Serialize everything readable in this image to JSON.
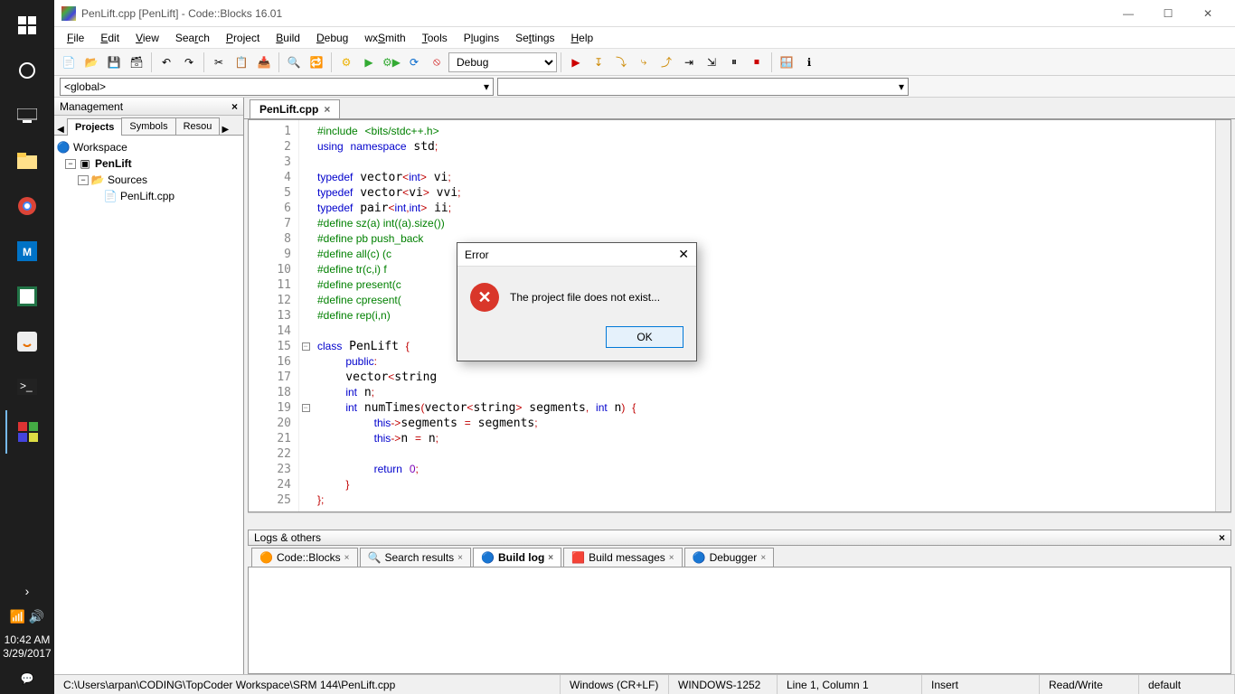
{
  "window": {
    "title": "PenLift.cpp [PenLift] - Code::Blocks 16.01"
  },
  "menu": [
    "File",
    "Edit",
    "View",
    "Search",
    "Project",
    "Build",
    "Debug",
    "wxSmith",
    "Tools",
    "Plugins",
    "Settings",
    "Help"
  ],
  "toolbar_combo": "Debug",
  "scope": {
    "left": "<global>",
    "right": ""
  },
  "management": {
    "title": "Management",
    "tabs": [
      "Projects",
      "Symbols",
      "Resou"
    ],
    "active_tab": 0,
    "tree": {
      "workspace": "Workspace",
      "project": "PenLift",
      "folder": "Sources",
      "file": "PenLift.cpp"
    }
  },
  "editor": {
    "tab": "PenLift.cpp",
    "lines": [
      {
        "n": 1,
        "html": "<span class='pp'>#include</span> <span class='pp'>&lt;bits/stdc++.h&gt;</span>"
      },
      {
        "n": 2,
        "html": "<span class='kw'>using</span> <span class='kw'>namespace</span> std<span class='pn'>;</span>"
      },
      {
        "n": 3,
        "html": ""
      },
      {
        "n": 4,
        "html": "<span class='kw'>typedef</span> vector<span class='pn'>&lt;</span><span class='kw'>int</span><span class='pn'>&gt;</span> vi<span class='pn'>;</span>"
      },
      {
        "n": 5,
        "html": "<span class='kw'>typedef</span> vector<span class='pn'>&lt;</span>vi<span class='pn'>&gt;</span> vvi<span class='pn'>;</span>"
      },
      {
        "n": 6,
        "html": "<span class='kw'>typedef</span> pair<span class='pn'>&lt;</span><span class='kw'>int</span><span class='pn'>,</span><span class='kw'>int</span><span class='pn'>&gt;</span> ii<span class='pn'>;</span>"
      },
      {
        "n": 7,
        "html": "<span class='pp'>#define sz(a) int((a).size())</span>"
      },
      {
        "n": 8,
        "html": "<span class='pp'>#define pb push_back</span>"
      },
      {
        "n": 9,
        "html": "<span class='pp'>#define all(c) (c</span>"
      },
      {
        "n": 10,
        "html": "<span class='pp'>#define tr(c,i) f</span>                                  end<span class='pn'>()</span><span class='pn'>;</span> i<span class='pn'>++)</span>"
      },
      {
        "n": 11,
        "html": "<span class='pp'>#define present(c</span>"
      },
      {
        "n": 12,
        "html": "<span class='pp'>#define cpresent(</span>"
      },
      {
        "n": 13,
        "html": "<span class='pp'>#define rep(i,n) </span>"
      },
      {
        "n": 14,
        "html": ""
      },
      {
        "n": 15,
        "html": "<span class='kw'>class</span> PenLift <span class='pn'>{</span>"
      },
      {
        "n": 16,
        "html": "    <span class='kw'>public</span><span class='pn'>:</span>"
      },
      {
        "n": 17,
        "html": "    vector<span class='pn'>&lt;</span>string"
      },
      {
        "n": 18,
        "html": "    <span class='kw'>int</span> n<span class='pn'>;</span>"
      },
      {
        "n": 19,
        "html": "    <span class='kw'>int</span> numTimes<span class='pn'>(</span>vector<span class='pn'>&lt;</span>string<span class='pn'>&gt;</span> segments<span class='pn'>,</span> <span class='kw'>int</span> n<span class='pn'>)</span> <span class='pn'>{</span>"
      },
      {
        "n": 20,
        "html": "        <span class='kw'>this</span><span class='pn'>-&gt;</span>segments <span class='pn'>=</span> segments<span class='pn'>;</span>"
      },
      {
        "n": 21,
        "html": "        <span class='kw'>this</span><span class='pn'>-&gt;</span>n <span class='pn'>=</span> n<span class='pn'>;</span>"
      },
      {
        "n": 22,
        "html": ""
      },
      {
        "n": 23,
        "html": "        <span class='kw'>return</span> <span class='ty'>0</span><span class='pn'>;</span>"
      },
      {
        "n": 24,
        "html": "    <span class='pn'>}</span>"
      },
      {
        "n": 25,
        "html": "<span class='pn'>};</span>"
      }
    ]
  },
  "logs": {
    "title": "Logs & others",
    "tabs": [
      "Code::Blocks",
      "Search results",
      "Build log",
      "Build messages",
      "Debugger"
    ],
    "active": 2
  },
  "status": {
    "path": "C:\\Users\\arpan\\CODING\\TopCoder Workspace\\SRM 144\\PenLift.cpp",
    "eol": "Windows (CR+LF)",
    "enc": "WINDOWS-1252",
    "pos": "Line 1, Column 1",
    "ins": "Insert",
    "rw": "Read/Write",
    "prof": "default"
  },
  "dialog": {
    "title": "Error",
    "message": "The project file does not exist...",
    "ok": "OK"
  },
  "clock": {
    "time": "10:42 AM",
    "date": "3/29/2017"
  }
}
